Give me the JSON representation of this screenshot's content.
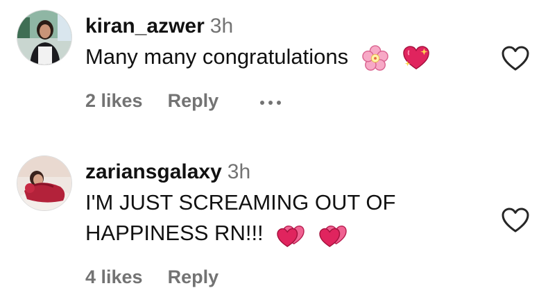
{
  "comments": [
    {
      "username": "kiran_azwer",
      "time": "3h",
      "text": "Many many congratulations",
      "emojis": [
        "cherry-blossom-icon",
        "sparkling-heart-icon"
      ],
      "likes": "2 likes",
      "reply": "Reply"
    },
    {
      "username": "zariansgalaxy",
      "time": "3h",
      "text_line1": "I'M JUST SCREAMING OUT OF",
      "text_line2": "HAPPINESS RN!!!",
      "emojis": [
        "two-hearts-icon",
        "two-hearts-icon"
      ],
      "likes": "4 likes",
      "reply": "Reply"
    }
  ],
  "colors": {
    "text": "#111111",
    "muted": "#737373",
    "heart_outline": "#262626",
    "emoji_red": "#e0245e"
  }
}
